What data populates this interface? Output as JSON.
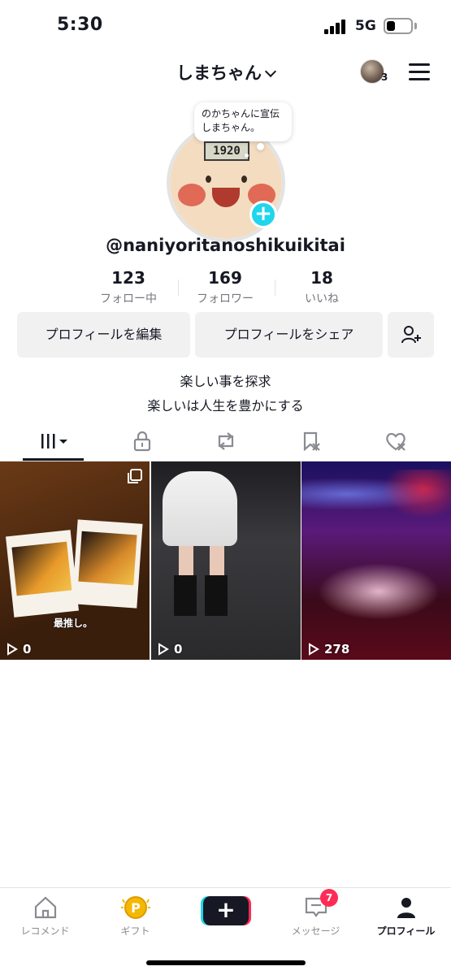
{
  "status_bar": {
    "time": "5:30",
    "network": "5G"
  },
  "header": {
    "username": "しまちゃん",
    "account_count": "3"
  },
  "profile": {
    "note": "のかちゃんに宣伝しまちゃん。",
    "avatar_sign_text": "1920",
    "handle": "@naniyoritanoshikuikitai"
  },
  "stats": [
    {
      "value": "123",
      "label": "フォロー中"
    },
    {
      "value": "169",
      "label": "フォロワー"
    },
    {
      "value": "18",
      "label": "いいね"
    }
  ],
  "actions": {
    "edit_profile": "プロフィールを編集",
    "share_profile": "プロフィールをシェア"
  },
  "bio": {
    "line1": "楽しい事を探求",
    "line2": "楽しいは人生を豊かにする"
  },
  "tabs": [
    {
      "icon": "grid-icon",
      "active": true
    },
    {
      "icon": "lock-icon"
    },
    {
      "icon": "repost-icon"
    },
    {
      "icon": "saved-icon"
    },
    {
      "icon": "liked-icon"
    }
  ],
  "videos": [
    {
      "views": "0",
      "caption": "最推し。",
      "pinned_icon": "multi-image-icon"
    },
    {
      "views": "0"
    },
    {
      "views": "278"
    }
  ],
  "bottom_nav": {
    "home": "レコメンド",
    "gift": "ギフト",
    "inbox": "メッセージ",
    "inbox_badge": "7",
    "profile": "プロフィール"
  },
  "colors": {
    "accent_cyan": "#20d5ec",
    "accent_red": "#fe2c55",
    "text_primary": "#161823",
    "text_secondary": "#75777e",
    "button_bg": "#f1f1f2"
  }
}
